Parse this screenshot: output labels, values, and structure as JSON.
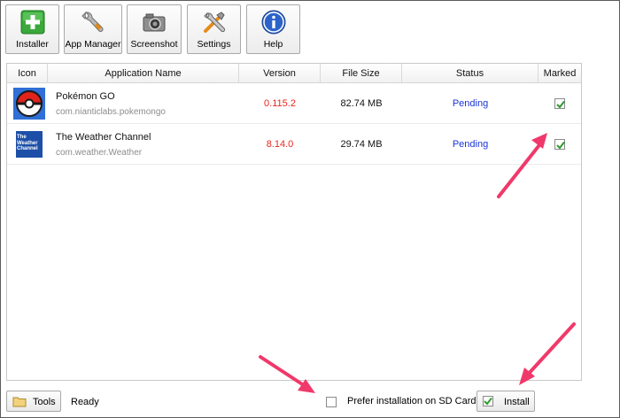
{
  "toolbar": {
    "buttons": [
      {
        "label": "Installer",
        "icon": "plus-icon"
      },
      {
        "label": "App Manager",
        "icon": "wrench-icon"
      },
      {
        "label": "Screenshot",
        "icon": "camera-icon"
      },
      {
        "label": "Settings",
        "icon": "tools-icon"
      },
      {
        "label": "Help",
        "icon": "info-icon"
      }
    ]
  },
  "table": {
    "columns": [
      "Icon",
      "Application Name",
      "Version",
      "File Size",
      "Status",
      "Marked"
    ],
    "rows": [
      {
        "name": "Pokémon GO",
        "package": "com.nianticlabs.pokemongo",
        "version": "0.115.2",
        "size": "82.74 MB",
        "status": "Pending",
        "marked": true,
        "icon": "pokeball-icon"
      },
      {
        "name": "The Weather Channel",
        "package": "com.weather.Weather",
        "version": "8.14.0",
        "size": "29.74 MB",
        "status": "Pending",
        "marked": true,
        "icon": "weather-channel-icon",
        "icon_text": "The Weather Channel"
      }
    ]
  },
  "bottom": {
    "tools_label": "Tools",
    "status_text": "Ready",
    "sd_label": "Prefer installation on SD Card",
    "sd_checked": false,
    "install_label": "Install"
  },
  "colors": {
    "version": "#e8261f",
    "status": "#1a34d6",
    "annotation_arrow": "#f0396a"
  }
}
